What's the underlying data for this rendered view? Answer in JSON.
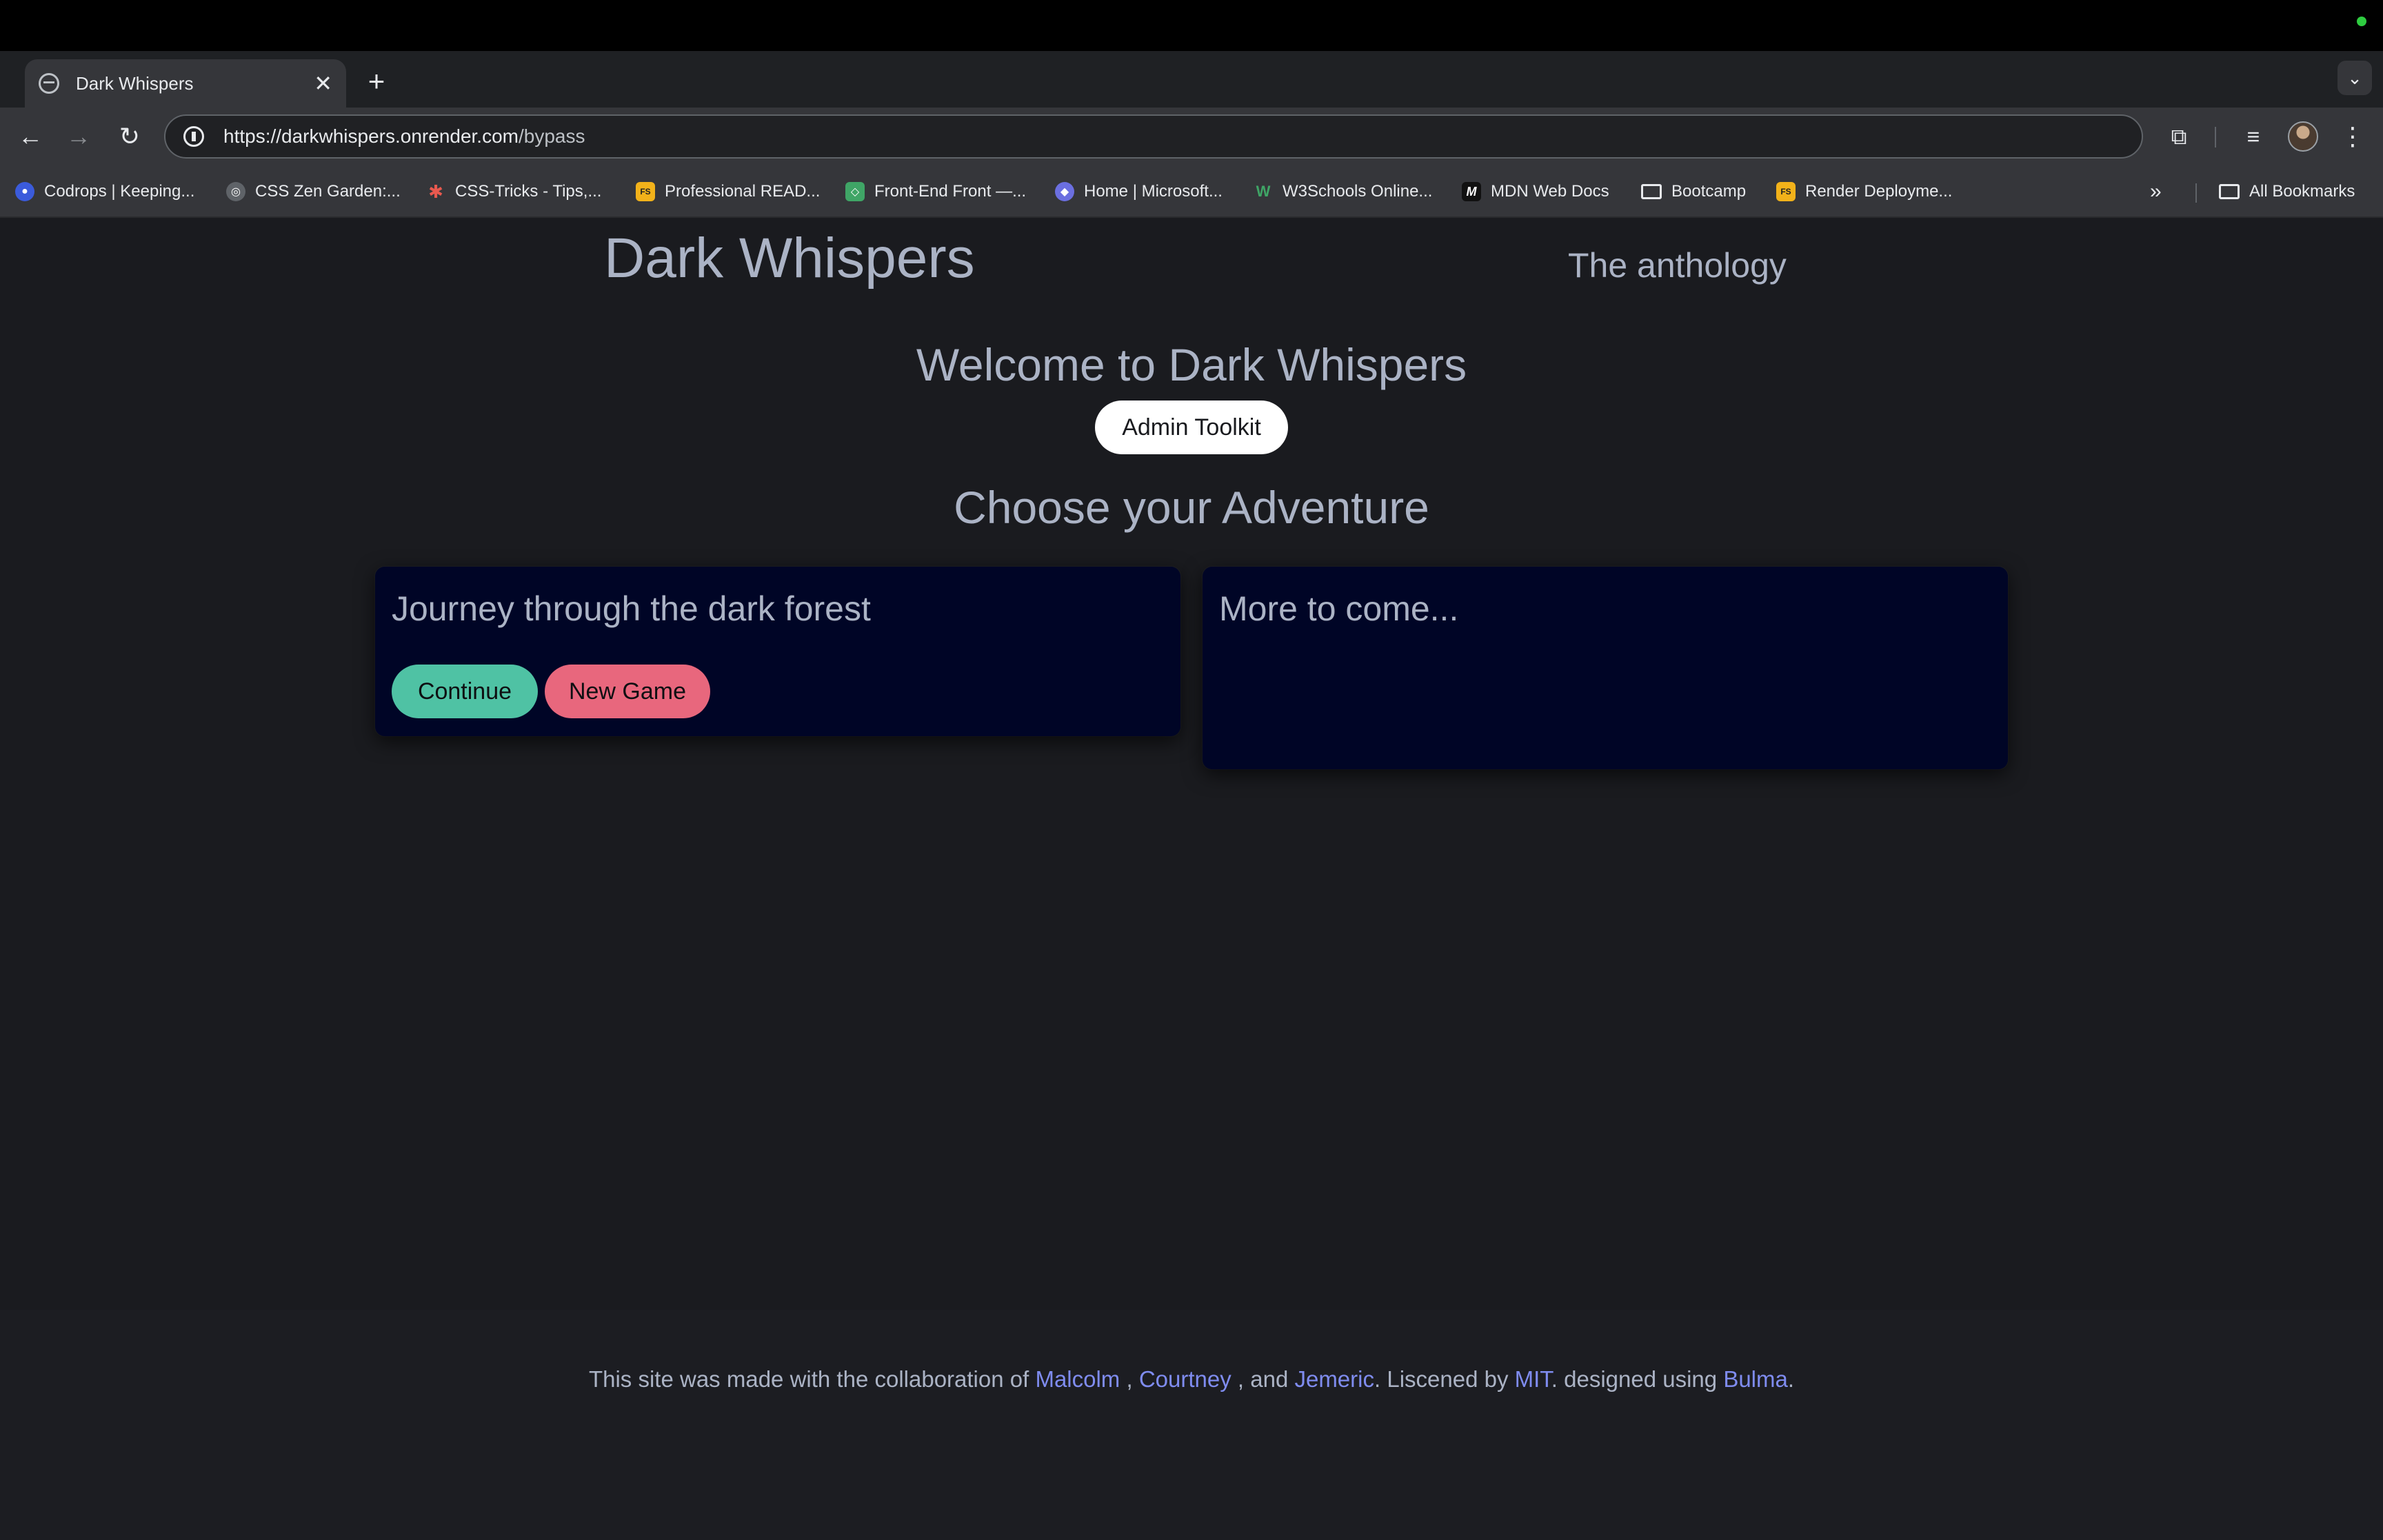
{
  "browser": {
    "tab_title": "Dark Whispers",
    "tab_close": "✕",
    "new_tab": "+",
    "url_host": "https://darkwhispers.onrender.com",
    "url_path": "/bypass",
    "bookmarks": [
      {
        "label": "Codrops | Keeping...",
        "icon_color": "#3b5bdb",
        "icon_glyph": "●"
      },
      {
        "label": "CSS Zen Garden:...",
        "icon_color": "#5f6368",
        "icon_glyph": "◎"
      },
      {
        "label": "CSS-Tricks - Tips,...",
        "icon_color": "#e8594f",
        "icon_glyph": "✱"
      },
      {
        "label": "Professional READ...",
        "icon_color": "#f2b21a",
        "icon_glyph": "FS"
      },
      {
        "label": "Front-End Front —...",
        "icon_color": "#3fa566",
        "icon_glyph": "◇"
      },
      {
        "label": "Home | Microsoft...",
        "icon_color": "#6b6fe0",
        "icon_glyph": "◆"
      },
      {
        "label": "W3Schools Online...",
        "icon_color": "#2f8a4a",
        "icon_glyph": "W"
      },
      {
        "label": "MDN Web Docs",
        "icon_color": "#111111",
        "icon_glyph": "M"
      },
      {
        "label": "Bootcamp",
        "icon_color": "",
        "icon_glyph": ""
      },
      {
        "label": "Render Deployme...",
        "icon_color": "#f2b21a",
        "icon_glyph": "FS"
      }
    ],
    "more_bookmarks": "»",
    "all_bookmarks": "All Bookmarks"
  },
  "header": {
    "title": "Dark Whispers",
    "subtitle": "The anthology"
  },
  "main": {
    "welcome": "Welcome to Dark Whispers",
    "admin_button": "Admin Toolkit",
    "choose": "Choose your Adventure",
    "cards": [
      {
        "title": "Journey through the dark forest",
        "continue_label": "Continue",
        "new_game_label": "New Game"
      },
      {
        "title": "More to come..."
      }
    ]
  },
  "footer": {
    "text_1": "This site was made with the collaboration of ",
    "link_1": "Malcolm",
    "text_2": " , ",
    "link_2": "Courtney",
    "text_3": " , and ",
    "link_3": "Jemeric",
    "text_4": ". Liscened by ",
    "link_4": "MIT",
    "text_5": ". designed using ",
    "link_5": "Bulma",
    "text_6": "."
  },
  "colors": {
    "page_bg": "#1a1b1f",
    "card_bg": "#000526",
    "text": "#abb3c5",
    "continue": "#4fc2a4",
    "new_game": "#e8677d",
    "link": "#7f8cf0"
  }
}
